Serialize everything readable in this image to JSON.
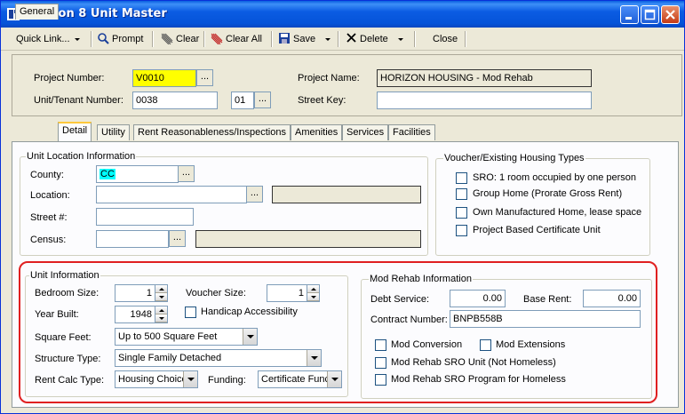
{
  "window": {
    "title": "Section 8 Unit Master"
  },
  "toolbar": {
    "quick_link": "Quick Link...",
    "prompt": "Prompt",
    "clear": "Clear",
    "clear_all": "Clear All",
    "save": "Save",
    "delete": "Delete",
    "close": "Close"
  },
  "header": {
    "project_number_label": "Project Number:",
    "project_number": "V0010",
    "project_name_label": "Project Name:",
    "project_name": "HORIZON HOUSING - Mod Rehab",
    "unit_tenant_label": "Unit/Tenant Number:",
    "unit_number": "0038",
    "tenant_number": "01",
    "street_key_label": "Street Key:",
    "street_key": "",
    "ellipsis": "..."
  },
  "tabs": [
    "General",
    "Detail",
    "Utility",
    "Rent Reasonableness/Inspections",
    "Amenities",
    "Services",
    "Facilities"
  ],
  "active_tab": "Detail",
  "unit_location": {
    "title": "Unit Location Information",
    "county_label": "County:",
    "county": "CC",
    "location_label": "Location:",
    "location": "",
    "street_label": "Street #:",
    "street": "",
    "census_label": "Census:",
    "census": ""
  },
  "voucher_types": {
    "title": "Voucher/Existing Housing Types",
    "options": [
      {
        "label": "SRO: 1 room occupied by one person",
        "checked": false
      },
      {
        "label": "Group Home (Prorate Gross Rent)",
        "checked": false
      },
      {
        "label": "Own Manufactured Home, lease space",
        "checked": false
      },
      {
        "label": "Project Based Certificate Unit",
        "checked": false
      }
    ]
  },
  "unit_info": {
    "title": "Unit Information",
    "bedroom_label": "Bedroom Size:",
    "bedroom": "1",
    "voucher_label": "Voucher Size:",
    "voucher": "1",
    "year_label": "Year Built:",
    "year": "1948",
    "handicap_label": "Handicap Accessibility",
    "sqft_label": "Square Feet:",
    "sqft": "Up to 500 Square Feet",
    "structure_label": "Structure Type:",
    "structure": "Single Family Detached",
    "rentcalc_label": "Rent Calc Type:",
    "rentcalc": "Housing Choice",
    "funding_label": "Funding:",
    "funding": "Certificate Func"
  },
  "mod_rehab": {
    "title": "Mod Rehab Information",
    "debt_label": "Debt Service:",
    "debt": "0.00",
    "base_rent_label": "Base Rent:",
    "base_rent": "0.00",
    "contract_label": "Contract Number:",
    "contract": "BNPB558B",
    "options": [
      {
        "label": "Mod Conversion",
        "checked": false
      },
      {
        "label": "Mod Extensions",
        "checked": false
      },
      {
        "label": "Mod Rehab SRO Unit (Not Homeless)",
        "checked": false
      },
      {
        "label": "Mod Rehab SRO Program for Homeless",
        "checked": false
      }
    ]
  },
  "colors": {
    "highlight": "#e02020",
    "required_field": "#ffff00",
    "county_field": "#00ffff"
  }
}
